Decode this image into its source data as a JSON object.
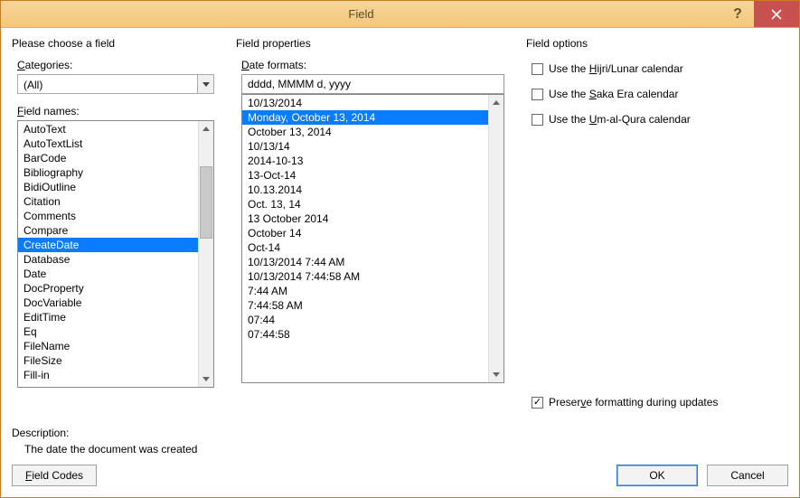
{
  "window": {
    "title": "Field"
  },
  "left": {
    "heading": "Please choose a field",
    "categories_label": "Categories:",
    "categories_value": "(All)",
    "fieldnames_label": "Field names:",
    "field_names": [
      "AutoText",
      "AutoTextList",
      "BarCode",
      "Bibliography",
      "BidiOutline",
      "Citation",
      "Comments",
      "Compare",
      "CreateDate",
      "Database",
      "Date",
      "DocProperty",
      "DocVariable",
      "EditTime",
      "Eq",
      "FileName",
      "FileSize",
      "Fill-in"
    ],
    "selected_field": "CreateDate"
  },
  "mid": {
    "heading": "Field properties",
    "formats_label": "Date formats:",
    "format_input": "dddd, MMMM d, yyyy",
    "formats": [
      "10/13/2014",
      "Monday, October 13, 2014",
      "October 13, 2014",
      "10/13/14",
      "2014-10-13",
      "13-Oct-14",
      "10.13.2014",
      "Oct. 13, 14",
      "13 October 2014",
      "October 14",
      "Oct-14",
      "10/13/2014 7:44 AM",
      "10/13/2014 7:44:58 AM",
      "7:44 AM",
      "7:44:58 AM",
      "07:44",
      "07:44:58"
    ],
    "selected_format": "Monday, October 13, 2014"
  },
  "right": {
    "heading": "Field options",
    "options": [
      {
        "label_pre": "Use the ",
        "label_u": "H",
        "label_post": "ijri/Lunar calendar",
        "checked": false
      },
      {
        "label_pre": "Use the ",
        "label_u": "S",
        "label_post": "aka Era calendar",
        "checked": false
      },
      {
        "label_pre": "Use the ",
        "label_u": "U",
        "label_post": "m-al-Qura calendar",
        "checked": false
      }
    ],
    "preserve": {
      "label_pre": "Preser",
      "label_u": "v",
      "label_post": "e formatting during updates",
      "checked": true
    }
  },
  "desc": {
    "label": "Description:",
    "text": "The date the document was created"
  },
  "buttons": {
    "field_codes": "Field Codes",
    "ok": "OK",
    "cancel": "Cancel"
  }
}
